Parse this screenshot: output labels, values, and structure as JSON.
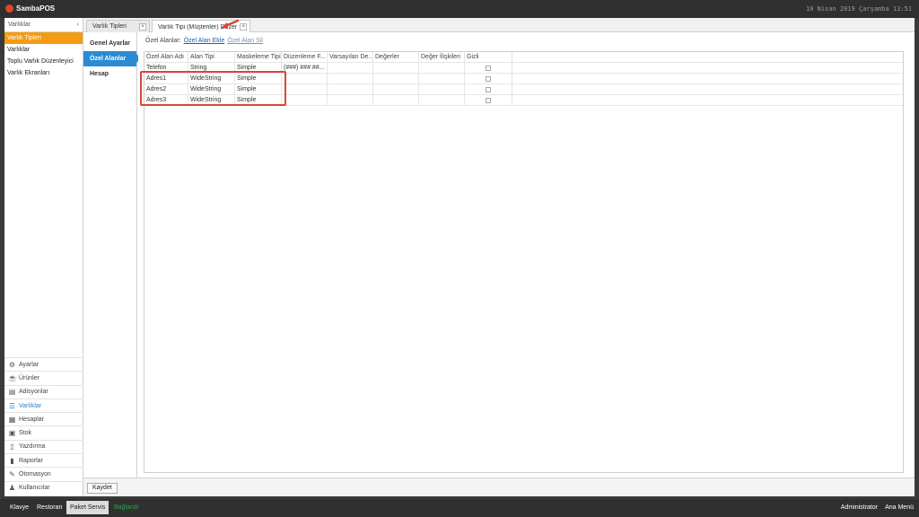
{
  "app": {
    "name": "SambaPOS",
    "datetime": "10 Nisan 2019 Çarşamba 13:51"
  },
  "left_panel": {
    "header": "Varlıklar",
    "collapse_glyph": "‹",
    "items": [
      {
        "label": "Varlık Tipleri",
        "active": true
      },
      {
        "label": "Varlıklar",
        "active": false
      },
      {
        "label": "Toplu Varlık Düzenleyici",
        "active": false
      },
      {
        "label": "Varlık Ekranları",
        "active": false
      }
    ],
    "nav": [
      {
        "label": "Ayarlar",
        "icon": "gear-icon",
        "glyph": "⚙",
        "active": false
      },
      {
        "label": "Ürünler",
        "icon": "coffee-icon",
        "glyph": "☕",
        "active": false
      },
      {
        "label": "Adisyonlar",
        "icon": "receipt-icon",
        "glyph": "▤",
        "active": false
      },
      {
        "label": "Varlıklar",
        "icon": "list-icon",
        "glyph": "☰",
        "active": true
      },
      {
        "label": "Hesaplar",
        "icon": "calculator-icon",
        "glyph": "▦",
        "active": false
      },
      {
        "label": "Stok",
        "icon": "box-icon",
        "glyph": "▣",
        "active": false
      },
      {
        "label": "Yazdırma",
        "icon": "document-icon",
        "glyph": "▯",
        "active": false
      },
      {
        "label": "Raporlar",
        "icon": "bar-chart-icon",
        "glyph": "▮",
        "active": false
      },
      {
        "label": "Otomasyon",
        "icon": "pencil-icon",
        "glyph": "✎",
        "active": false
      },
      {
        "label": "Kullanıcılar",
        "icon": "user-icon",
        "glyph": "♟",
        "active": false
      }
    ]
  },
  "tabs": [
    {
      "label": "Varlık Tipleri",
      "active": false,
      "close": "×"
    },
    {
      "label": "Varlık Tipi (Müşteriler) Düzenle",
      "active": true,
      "close": "×"
    }
  ],
  "subnav": [
    {
      "label": "Genel Ayarlar",
      "active": false
    },
    {
      "label": "Özel Alanlar",
      "active": true
    },
    {
      "label": "Hesap",
      "active": false
    }
  ],
  "toolbar": {
    "label": "Özel Alanlar:",
    "add": "Özel Alan Ekle",
    "delete": "Özel Alan Sil"
  },
  "grid": {
    "columns": [
      "Özel Alan Adı",
      "Alan Tipi",
      "Maskeleme Tipi",
      "Düzenleme F...",
      "Varsayılan De...",
      "Değerler",
      "Değer İlişkileri",
      "Gizli"
    ],
    "rows": [
      [
        "Telefon",
        "String",
        "Simple",
        "(###) ### ##...",
        "",
        "",
        "",
        false
      ],
      [
        "Adres1",
        "WideString",
        "Simple",
        "",
        "",
        "",
        "",
        false
      ],
      [
        "Adres2",
        "WideString",
        "Simple",
        "",
        "",
        "",
        "",
        false
      ],
      [
        "Adres3",
        "WideString",
        "Simple",
        "",
        "",
        "",
        "",
        false
      ]
    ]
  },
  "footer": {
    "save": "Kaydet"
  },
  "status_bar": {
    "buttons": [
      {
        "label": "Klavye",
        "light": false
      },
      {
        "label": "Restoran",
        "light": false
      },
      {
        "label": "Paket Servis",
        "light": true
      }
    ],
    "status": "Bağlandı",
    "user": "Administrator",
    "menu": "Ana Menü"
  },
  "colors": {
    "accent_orange": "#f39c12",
    "accent_blue": "#2a8bd4",
    "highlight_red": "#d9463a",
    "status_green": "#2fa24a"
  }
}
